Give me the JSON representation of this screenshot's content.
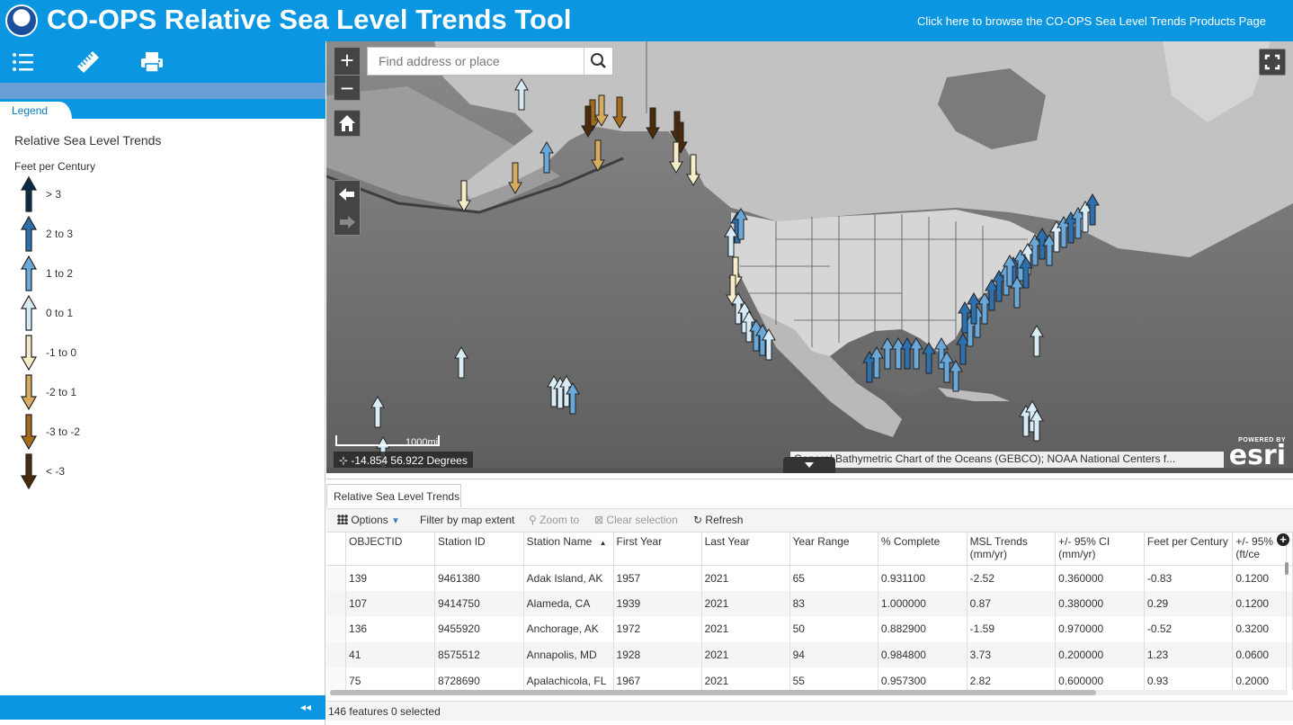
{
  "header": {
    "title": "CO-OPS Relative Sea Level Trends Tool",
    "link": "Click here to browse the CO-OPS Sea Level Trends Products Page",
    "color": "#0a96e0"
  },
  "left_panel": {
    "tools": [
      "layer-list-icon",
      "measure-icon",
      "print-icon"
    ],
    "tab": "Legend",
    "legend_title": "Relative Sea Level Trends",
    "legend_unit": "Feet per Century",
    "legend_items": [
      {
        "label": "> 3",
        "dir": "up",
        "color": "#0c2a4a"
      },
      {
        "label": "2 to 3",
        "dir": "up",
        "color": "#2e6fae"
      },
      {
        "label": "1 to 2",
        "dir": "up",
        "color": "#6aa8da"
      },
      {
        "label": "0 to 1",
        "dir": "up",
        "color": "#d8ecf8"
      },
      {
        "label": "-1 to 0",
        "dir": "down",
        "color": "#f6ecc8"
      },
      {
        "label": "-2 to 1",
        "dir": "down",
        "color": "#d6ad5e"
      },
      {
        "label": "-3 to -2",
        "dir": "down",
        "color": "#a66a1c"
      },
      {
        "label": "< -3",
        "dir": "down",
        "color": "#4a2a0c"
      }
    ],
    "collapse_glyph": "◂◂"
  },
  "map": {
    "zoom_in": "+",
    "zoom_out": "−",
    "search_placeholder": "Find address or place",
    "scale_label": "1000mi",
    "coords_text": "-14.854 56.922 Degrees",
    "attribution": "General Bathymetric Chart of the Oceans (GEBCO); NOAA National Centers f...",
    "esri_powered": "POWERED BY",
    "esri_word": "esri"
  },
  "table": {
    "tab": "Relative Sea Level Trends",
    "toolbar": {
      "options": "Options",
      "filter": "Filter by map extent",
      "zoom_to": "Zoom to",
      "clear_selection": "Clear selection",
      "refresh": "Refresh"
    },
    "columns": [
      "OBJECTID",
      "Station ID",
      "Station Name",
      "First Year",
      "Last Year",
      "Year Range",
      "% Complete",
      "MSL Trends (mm/yr)",
      "+/- 95% CI (mm/yr)",
      "Feet per Century",
      "+/- 95% (ft/ce"
    ],
    "rows": [
      [
        "139",
        "9461380",
        "Adak Island, AK",
        "1957",
        "2021",
        "65",
        "0.931100",
        "-2.52",
        "0.360000",
        "-0.83",
        "0.1200"
      ],
      [
        "107",
        "9414750",
        "Alameda, CA",
        "1939",
        "2021",
        "83",
        "1.000000",
        "0.87",
        "0.380000",
        "0.29",
        "0.1200"
      ],
      [
        "136",
        "9455920",
        "Anchorage, AK",
        "1972",
        "2021",
        "50",
        "0.882900",
        "-1.59",
        "0.970000",
        "-0.52",
        "0.3200"
      ],
      [
        "41",
        "8575512",
        "Annapolis, MD",
        "1928",
        "2021",
        "94",
        "0.984800",
        "3.73",
        "0.200000",
        "1.23",
        "0.0600"
      ],
      [
        "75",
        "8728690",
        "Apalachicola, FL",
        "1967",
        "2021",
        "55",
        "0.957300",
        "2.82",
        "0.600000",
        "0.93",
        "0.2000"
      ]
    ],
    "status": "146 features 0 selected"
  }
}
